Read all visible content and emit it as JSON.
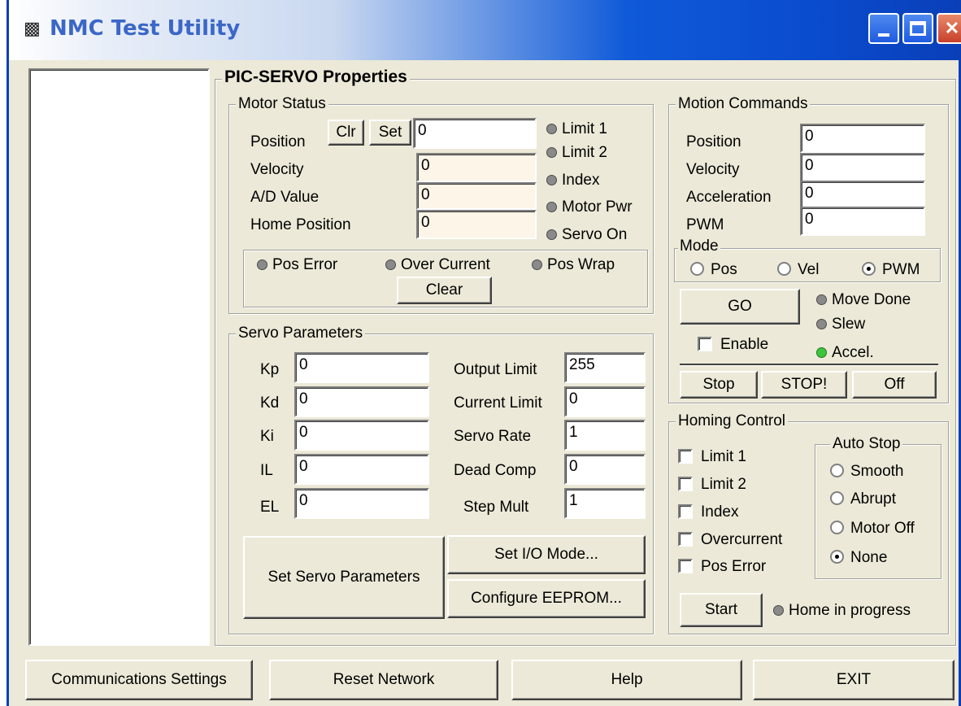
{
  "window": {
    "title": "NMC Test Utility"
  },
  "pic_servo": {
    "title": "PIC-SERVO Properties",
    "motor_status": {
      "title": "Motor Status",
      "position_label": "Position",
      "clr_label": "Clr",
      "set_label": "Set",
      "position_value": "0",
      "velocity_label": "Velocity",
      "velocity_value": "0",
      "ad_label": "A/D Value",
      "ad_value": "0",
      "home_label": "Home Position",
      "home_value": "0",
      "indicators": [
        "Limit 1",
        "Limit 2",
        "Index",
        "Motor Pwr",
        "Servo On"
      ],
      "errors": [
        "Pos Error",
        "Over Current",
        "Pos Wrap"
      ],
      "clear_label": "Clear"
    },
    "servo_params": {
      "title": "Servo Parameters",
      "kp_label": "Kp",
      "kp": "0",
      "kd_label": "Kd",
      "kd": "0",
      "ki_label": "Ki",
      "ki": "0",
      "il_label": "IL",
      "il": "0",
      "el_label": "EL",
      "el": "0",
      "output_limit_label": "Output Limit",
      "output_limit": "255",
      "current_limit_label": "Current Limit",
      "current_limit": "0",
      "servo_rate_label": "Servo Rate",
      "servo_rate": "1",
      "dead_comp_label": "Dead Comp",
      "dead_comp": "0",
      "step_mult_label": "Step Mult",
      "step_mult": "1",
      "set_servo_label": "Set Servo Parameters",
      "set_io_label": "Set I/O Mode...",
      "eeprom_label": "Configure EEPROM..."
    },
    "motion": {
      "title": "Motion Commands",
      "position_label": "Position",
      "position": "0",
      "velocity_label": "Velocity",
      "velocity": "0",
      "accel_label": "Acceleration",
      "accel": "0",
      "pwm_label": "PWM",
      "pwm": "0",
      "mode_title": "Mode",
      "mode_pos": "Pos",
      "mode_vel": "Vel",
      "mode_pwm": "PWM",
      "mode_selected": "PWM",
      "go_label": "GO",
      "enable_label": "Enable",
      "move_done": "Move Done",
      "slew": "Slew",
      "accel_ind": "Accel.",
      "accel_on": true,
      "stop_label": "Stop",
      "stop_bang_label": "STOP!",
      "off_label": "Off"
    },
    "homing": {
      "title": "Homing Control",
      "checks": [
        "Limit 1",
        "Limit 2",
        "Index",
        "Overcurrent",
        "Pos Error"
      ],
      "autostop_title": "Auto Stop",
      "autostop_options": [
        "Smooth",
        "Abrupt",
        "Motor Off",
        "None"
      ],
      "autostop_selected": "None",
      "start_label": "Start",
      "progress_label": "Home in progress"
    }
  },
  "bottom": {
    "comm_label": "Communications Settings",
    "reset_label": "Reset Network",
    "help_label": "Help",
    "exit_label": "EXIT"
  },
  "colors": {
    "titlebar": "#0a4bcd",
    "panel": "#ece9d8",
    "led_off": "#8a8a8a",
    "led_on": "#3cc43c"
  }
}
